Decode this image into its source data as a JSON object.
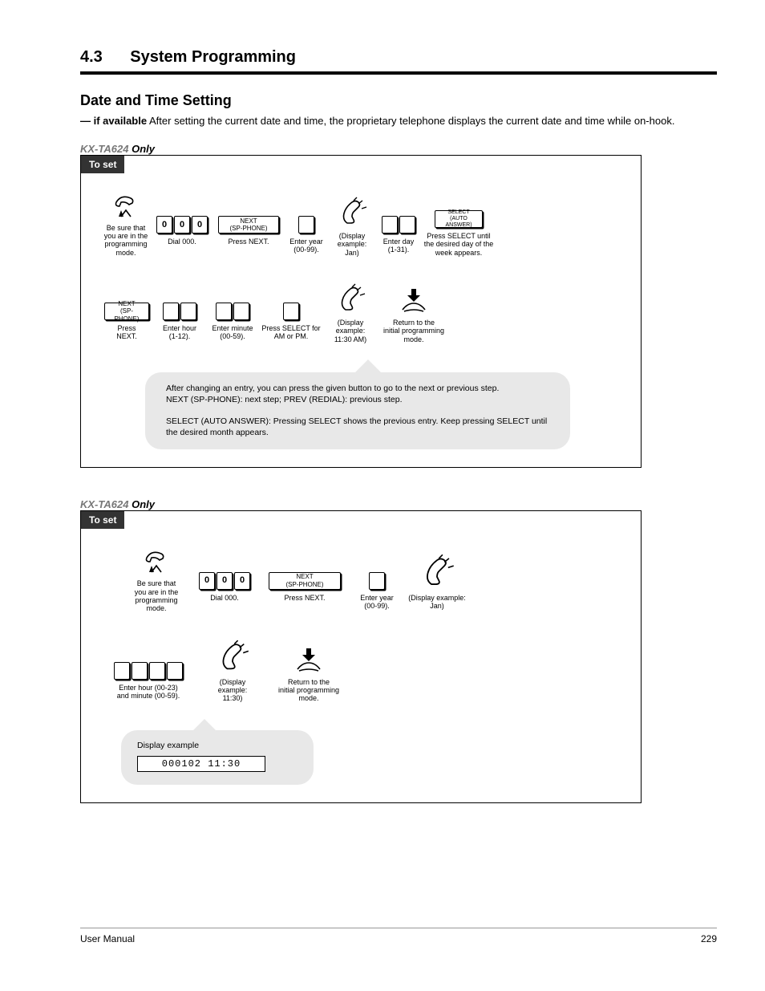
{
  "header": {
    "title": "4.3",
    "subtitle": "System Programming"
  },
  "section": {
    "heading": "Date and Time Setting",
    "intro_b": "— if available",
    "intro_plain": "After setting the current date and time, the proprietary telephone displays the current date and time while on-hook."
  },
  "pbx_labels": {
    "suffix": "Only"
  },
  "panel1": {
    "tab": "To set",
    "step1": "Be sure that\nyou are in the\nprogramming mode.",
    "step2_keys": [
      "0",
      "0",
      "0"
    ],
    "step2": "Dial 000.",
    "step3_btn": "NEXT\n(SP-PHONE)",
    "step3": "Press NEXT.",
    "step4_keys_count": 1,
    "step4": "Enter year\n(00-99).",
    "step5": "(Display example:\nJan)",
    "step6_keys_count": 2,
    "step6": "Enter day\n(1-31).",
    "step7_btn": "SELECT\n(AUTO ANSWER)",
    "step7": "Press SELECT until\nthe desired day of the\nweek appears.",
    "r2_step1_btn": "NEXT\n(SP-PHONE)",
    "r2_step1": "Press\nNEXT.",
    "r2_step2_keys_count": 2,
    "r2_step2": "Enter hour\n(1-12).",
    "r2_step3_keys_count": 2,
    "r2_step3": "Enter minute\n(00-59).",
    "r2_step4_keys_count": 1,
    "r2_step4": "Press SELECT for\nAM or PM.",
    "r2_step5": "(Display\nexample:\n11:30 AM)",
    "r2_step6": "Return to the\ninitial programming\nmode.",
    "callout": "After changing an entry, you can press the given button to go to the next or previous step.\nNEXT (SP-PHONE): next step; PREV (REDIAL): previous step.\n\nSELECT (AUTO ANSWER): Pressing SELECT shows the previous entry. Keep pressing SELECT until the desired month appears."
  },
  "panel2": {
    "tab": "To set",
    "step1": "Be sure that\nyou are in the\nprogramming mode.",
    "step2_keys": [
      "0",
      "0",
      "0"
    ],
    "step2": "Dial 000.",
    "step3_btn": "NEXT\n(SP-PHONE)",
    "step3": "Press NEXT.",
    "step4_keys_count": 1,
    "step4": "Enter year\n(00-99).",
    "step5": "(Display example:\nJan)",
    "r2_step1_keys_count": 4,
    "r2_step1": "Enter hour (00-23)\nand minute (00-59).",
    "r2_step2": "(Display\nexample:\n11:30)",
    "r2_step3": "Return to the\ninitial programming\nmode.",
    "callout_text": "Display example",
    "lcd": "000102  11:30"
  },
  "footer": {
    "left": "User Manual",
    "right": "229"
  }
}
